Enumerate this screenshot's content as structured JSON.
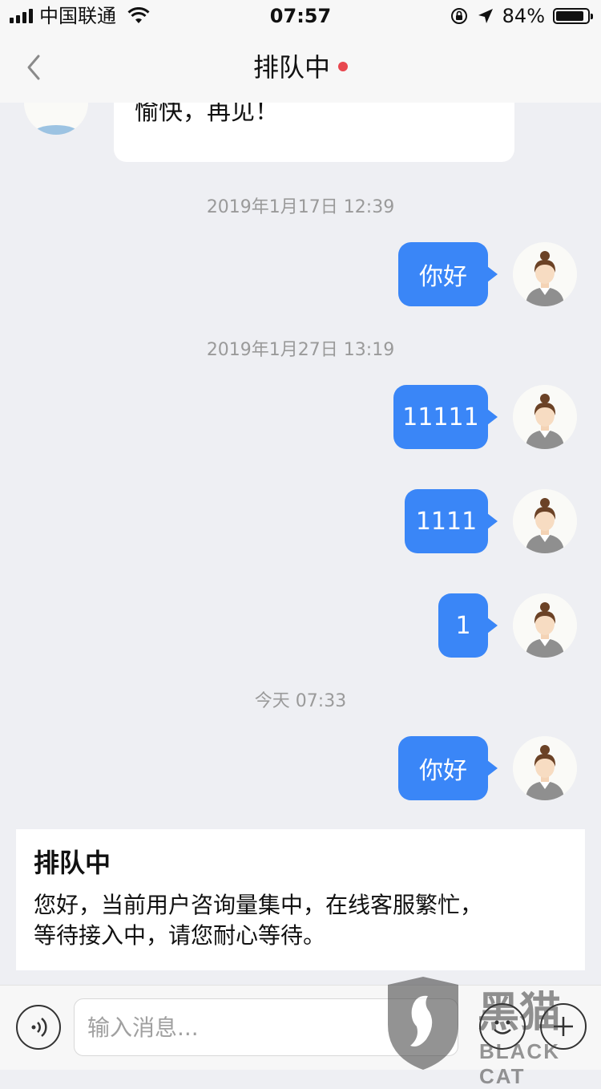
{
  "status_bar": {
    "carrier": "中国联通",
    "time": "07:57",
    "battery_percent": "84%",
    "battery_level": 0.84,
    "icons": [
      "signal-icon",
      "wifi-icon",
      "orientation-lock-icon",
      "location-arrow-icon",
      "battery-icon"
    ]
  },
  "nav": {
    "title": "排队中",
    "status_dot_color": "#e8474f"
  },
  "chat": {
    "previous_agent_message_tail": "愉快，再见！",
    "messages": [
      {
        "timestamp": "2019年1月17日 12:39",
        "text": "你好"
      },
      {
        "timestamp": "2019年1月27日 13:19",
        "text": "11111"
      },
      {
        "timestamp": "",
        "text": "1111"
      },
      {
        "timestamp": "",
        "text": "1"
      },
      {
        "timestamp": "今天 07:33",
        "text": "你好"
      }
    ],
    "bubble_color": "#3a86f7"
  },
  "queue_card": {
    "title": "排队中",
    "line1": "您好，当前用户咨询量集中，在线客服繁忙，",
    "line2": "等待接入中，请您耐心等待。"
  },
  "input_bar": {
    "placeholder": "输入消息...",
    "icons": [
      "voice-icon",
      "emoji-icon",
      "plus-icon"
    ]
  },
  "watermark": {
    "text_cn": "黑猫",
    "text_en": "BLACK CAT"
  }
}
